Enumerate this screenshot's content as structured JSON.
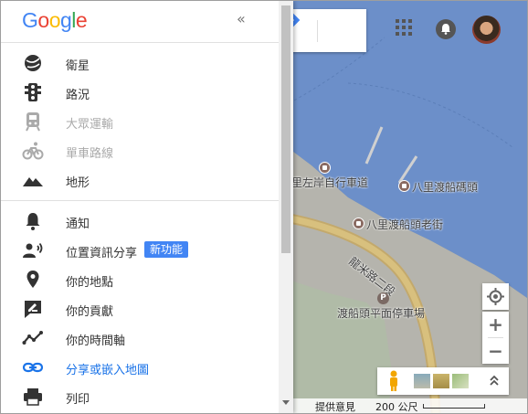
{
  "header": {
    "logo_letters": [
      {
        "char": "G",
        "color": "#4285F4"
      },
      {
        "char": "o",
        "color": "#EA4335"
      },
      {
        "char": "o",
        "color": "#FBBC05"
      },
      {
        "char": "g",
        "color": "#4285F4"
      },
      {
        "char": "l",
        "color": "#34A853"
      },
      {
        "char": "e",
        "color": "#EA4335"
      }
    ],
    "collapse_glyph": "«"
  },
  "menu": {
    "layers": [
      {
        "label": "衛星",
        "icon": "satellite-globe-icon",
        "enabled": true
      },
      {
        "label": "路況",
        "icon": "traffic-light-icon",
        "enabled": true
      },
      {
        "label": "大眾運輸",
        "icon": "transit-train-icon",
        "enabled": false
      },
      {
        "label": "單車路線",
        "icon": "bicycle-icon",
        "enabled": false
      },
      {
        "label": "地形",
        "icon": "terrain-mountain-icon",
        "enabled": true
      }
    ],
    "actions": [
      {
        "label": "通知",
        "icon": "bell-icon"
      },
      {
        "label": "位置資訊分享",
        "icon": "location-sharing-icon"
      },
      {
        "label": "你的地點",
        "icon": "place-pin-icon"
      },
      {
        "label": "你的貢獻",
        "icon": "contribution-edit-icon"
      },
      {
        "label": "你的時間軸",
        "icon": "timeline-icon"
      },
      {
        "label": "分享或嵌入地圖",
        "icon": "link-icon"
      },
      {
        "label": "列印",
        "icon": "print-icon"
      }
    ],
    "new_badge": "新功能"
  },
  "map": {
    "labels": {
      "bike_path": "里左岸自行車道",
      "ferry_pier": "八里渡船碼頭",
      "ferry_street": "八里渡船頭老街",
      "road": "龍米路二段",
      "parking": "渡船頭平面停車場"
    },
    "parking_glyph": "P"
  },
  "footer": {
    "feedback": "提供意見",
    "scale": "200 公尺"
  },
  "colors": {
    "water": "#7aa7e3",
    "land": "#e8e6e1",
    "park": "#c8dfbf",
    "road": "#f6d987",
    "accent": "#4285f4"
  }
}
